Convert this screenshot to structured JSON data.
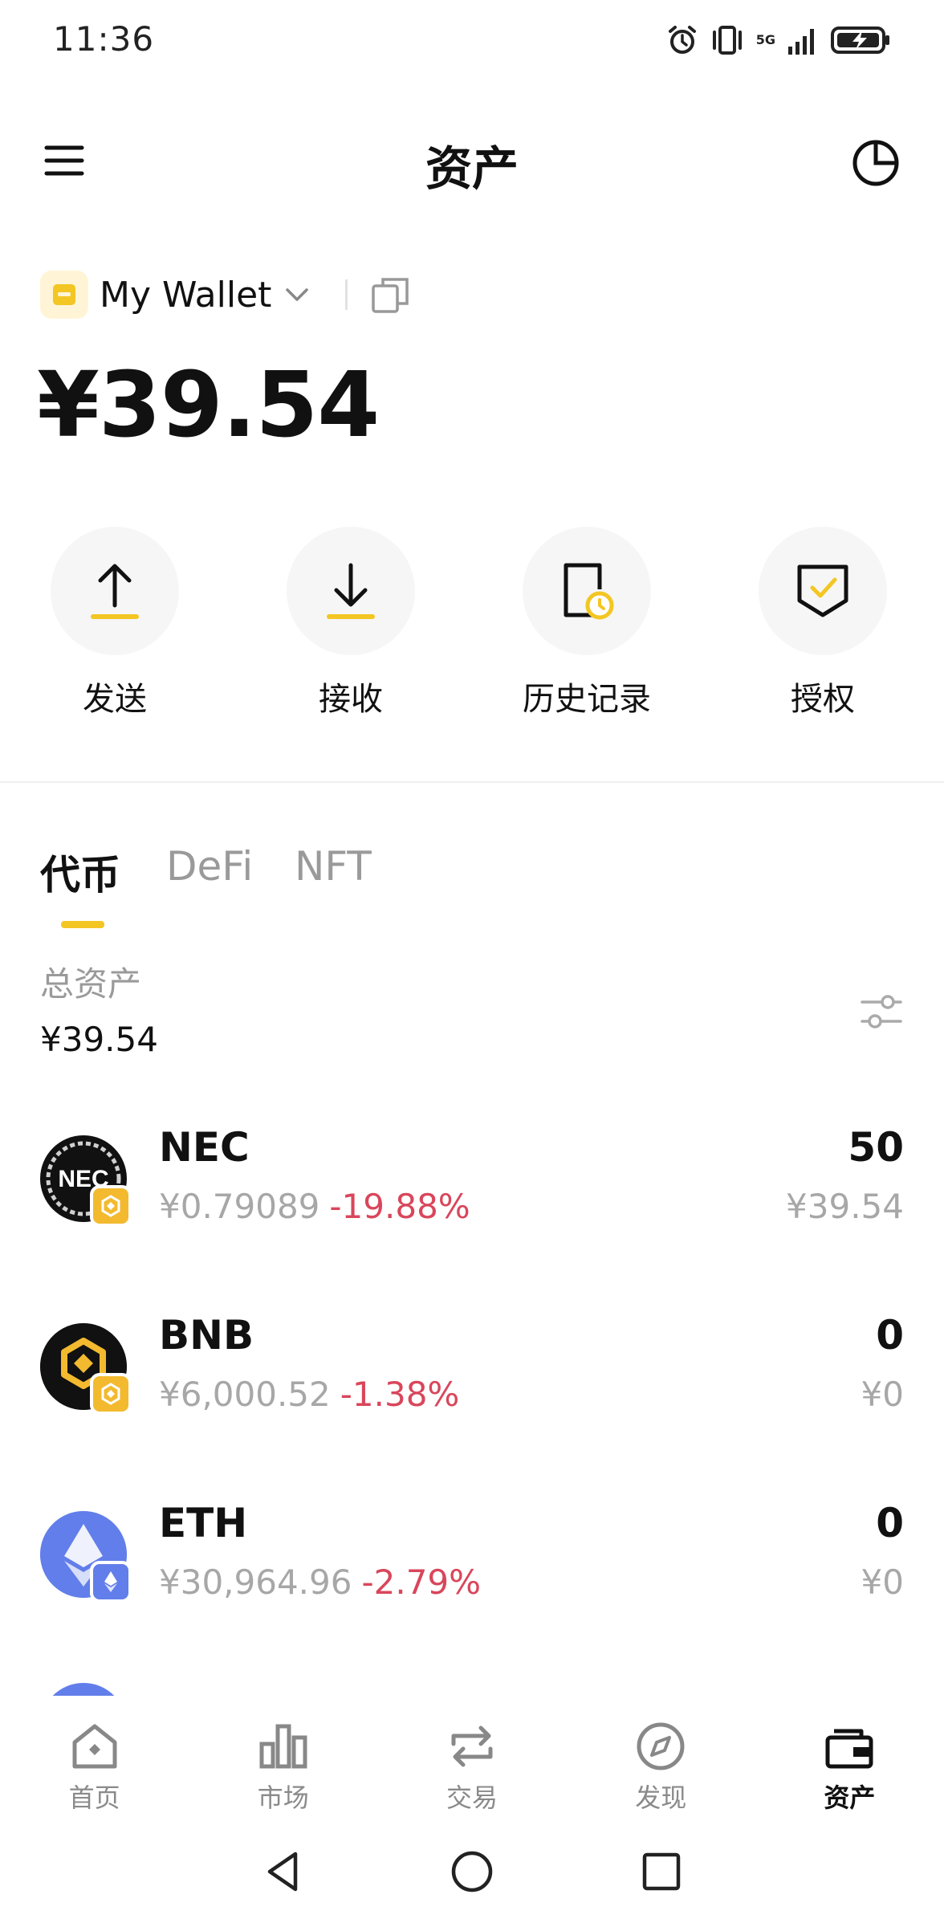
{
  "status_bar": {
    "time": "11:36",
    "network": "5G"
  },
  "header": {
    "title": "资产"
  },
  "wallet": {
    "name": "My Wallet",
    "balance": "¥39.54"
  },
  "actions": [
    {
      "label": "发送",
      "icon": "send-arrow-up-icon"
    },
    {
      "label": "接收",
      "icon": "receive-arrow-down-icon"
    },
    {
      "label": "历史记录",
      "icon": "history-clock-icon"
    },
    {
      "label": "授权",
      "icon": "authorize-shield-check-icon"
    }
  ],
  "tabs": [
    {
      "label": "代币",
      "active": true
    },
    {
      "label": "DeFi",
      "active": false
    },
    {
      "label": "NFT",
      "active": false
    }
  ],
  "summary": {
    "label": "总资产",
    "value": "¥39.54"
  },
  "tokens": [
    {
      "symbol": "NEC",
      "price": "¥0.79089",
      "change": "-19.88%",
      "quantity": "50",
      "fiat": "¥39.54",
      "chain": "bnb-chain-icon"
    },
    {
      "symbol": "BNB",
      "price": "¥6,000.52",
      "change": "-1.38%",
      "quantity": "0",
      "fiat": "¥0",
      "chain": "bnb-chain-icon"
    },
    {
      "symbol": "ETH",
      "price": "¥30,964.96",
      "change": "-2.79%",
      "quantity": "0",
      "fiat": "¥0",
      "chain": "eth-chain-icon"
    }
  ],
  "bottom_nav": [
    {
      "label": "首页",
      "icon": "home-icon"
    },
    {
      "label": "市场",
      "icon": "market-bar-chart-icon"
    },
    {
      "label": "交易",
      "icon": "swap-icon"
    },
    {
      "label": "发现",
      "icon": "compass-icon"
    },
    {
      "label": "资产",
      "icon": "wallet-icon",
      "active": true
    }
  ],
  "colors": {
    "accent": "#F3C623",
    "negative": "#D9465B",
    "muted": "#A7A7A7",
    "eth": "#627EEA"
  }
}
